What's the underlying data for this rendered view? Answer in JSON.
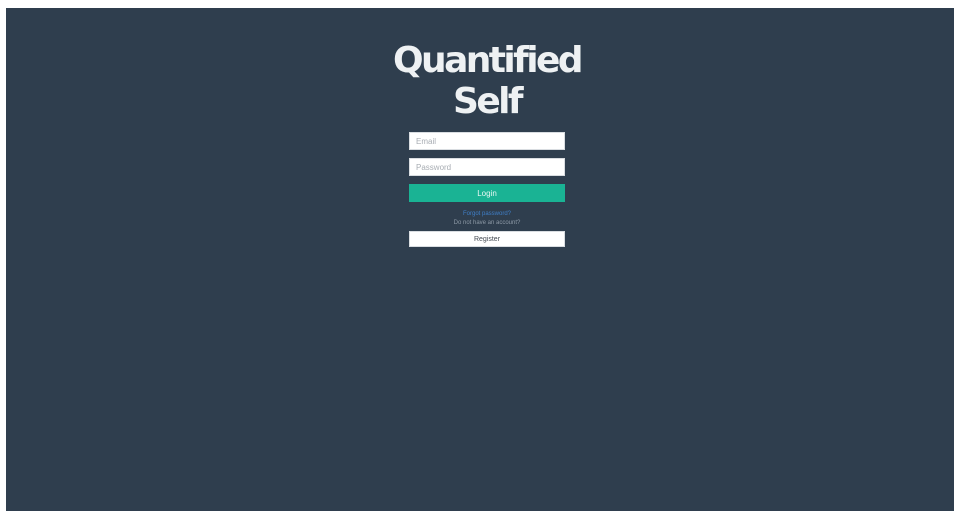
{
  "app": {
    "title_line1": "Quantified",
    "title_line2": "Self"
  },
  "form": {
    "email_placeholder": "Email",
    "email_value": "",
    "password_placeholder": "Password",
    "password_value": "",
    "login_label": "Login",
    "forgot_password_label": "Forgot password?",
    "no_account_text": "Do not have an account?",
    "register_label": "Register"
  },
  "colors": {
    "background": "#2f3e4e",
    "accent": "#1ab394",
    "link": "#3f7fc8"
  }
}
